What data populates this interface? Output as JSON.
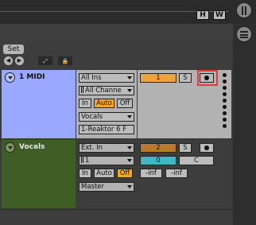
{
  "window": {
    "h_button": "H",
    "w_button": "W"
  },
  "set": {
    "label": "Set",
    "nav_left_glyph": "◀",
    "nav_right_glyph": "▶",
    "expand_glyph": "⤢",
    "lock_glyph": "🔒"
  },
  "tracks": [
    {
      "name": "1 MIDI",
      "color": "#9aa9ff",
      "input_type": "All Ins",
      "input_channel": "All Channe",
      "monitor": [
        "In",
        "Auto",
        "Off"
      ],
      "monitor_selected": "Auto",
      "output_type": "Vocals",
      "output_channel": "1-Reaktor 6 F",
      "track_number": "1",
      "solo": "S",
      "arm_highlighted": true
    },
    {
      "name": "Vocals",
      "color": "#3f5e27",
      "input_type": "Ext. In",
      "input_channel": "1",
      "monitor": [
        "In",
        "Auto",
        "Off"
      ],
      "monitor_selected": "Off",
      "output_type": "Master",
      "track_number": "2",
      "solo": "S",
      "volume": "0",
      "pan": "C",
      "peak_left": "-inf",
      "peak_right": "-inf"
    }
  ]
}
